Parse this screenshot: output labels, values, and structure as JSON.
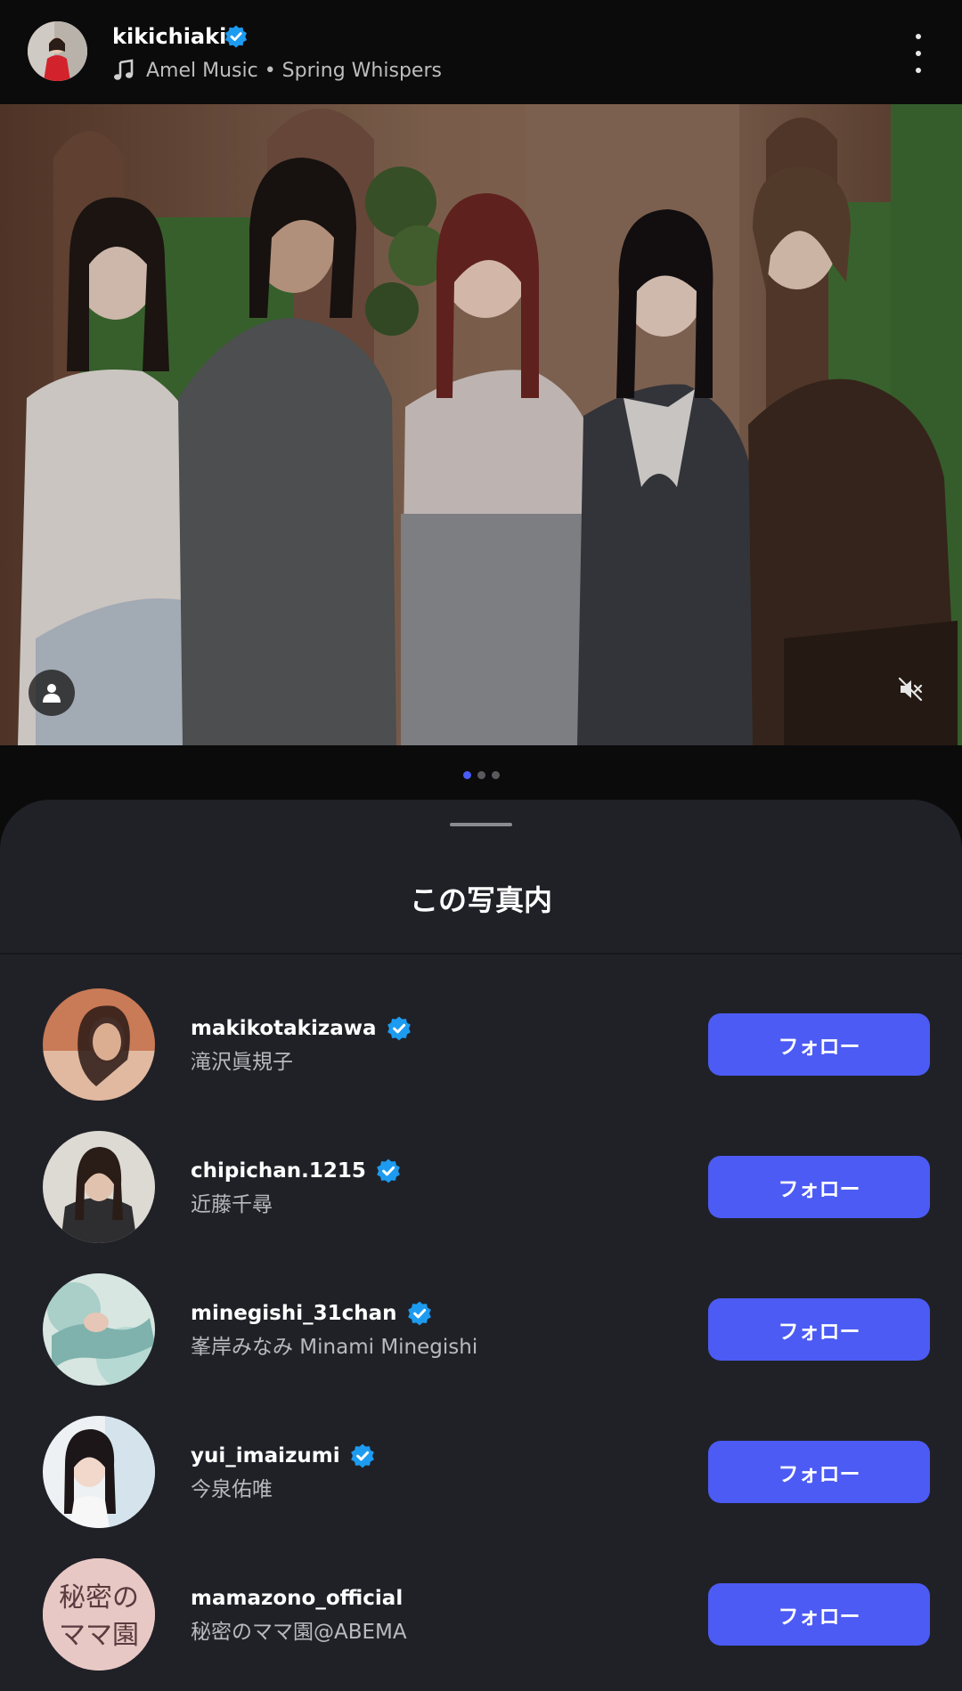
{
  "header": {
    "username": "kikichiaki",
    "music": "Amel Music • Spring Whispers",
    "verified_icon": "verified-badge-icon",
    "music_icon": "music-note-icon",
    "more_icon": "more-vertical-icon"
  },
  "carousel": {
    "total": 3,
    "active_index": 0,
    "tag_icon": "person-icon",
    "mute_icon": "speaker-muted-icon"
  },
  "sheet": {
    "title": "この写真内",
    "users": [
      {
        "handle": "makikotakizawa",
        "name": "滝沢眞規子",
        "verified": true,
        "follow_label": "フォロー"
      },
      {
        "handle": "chipichan.1215",
        "name": "近藤千尋",
        "verified": true,
        "follow_label": "フォロー"
      },
      {
        "handle": "minegishi_31chan",
        "name": "峯岸みなみ Minami Minegishi",
        "verified": true,
        "follow_label": "フォロー"
      },
      {
        "handle": "yui_imaizumi",
        "name": "今泉佑唯",
        "verified": true,
        "follow_label": "フォロー"
      },
      {
        "handle": "mamazono_official",
        "name": "秘密のママ園@ABEMA",
        "verified": false,
        "follow_label": "フォロー",
        "avatar_text": "秘密の ママ園"
      }
    ]
  },
  "colors": {
    "accent": "#4c5bf3",
    "verified": "#1d9bf0",
    "sheet_bg": "#202127"
  }
}
